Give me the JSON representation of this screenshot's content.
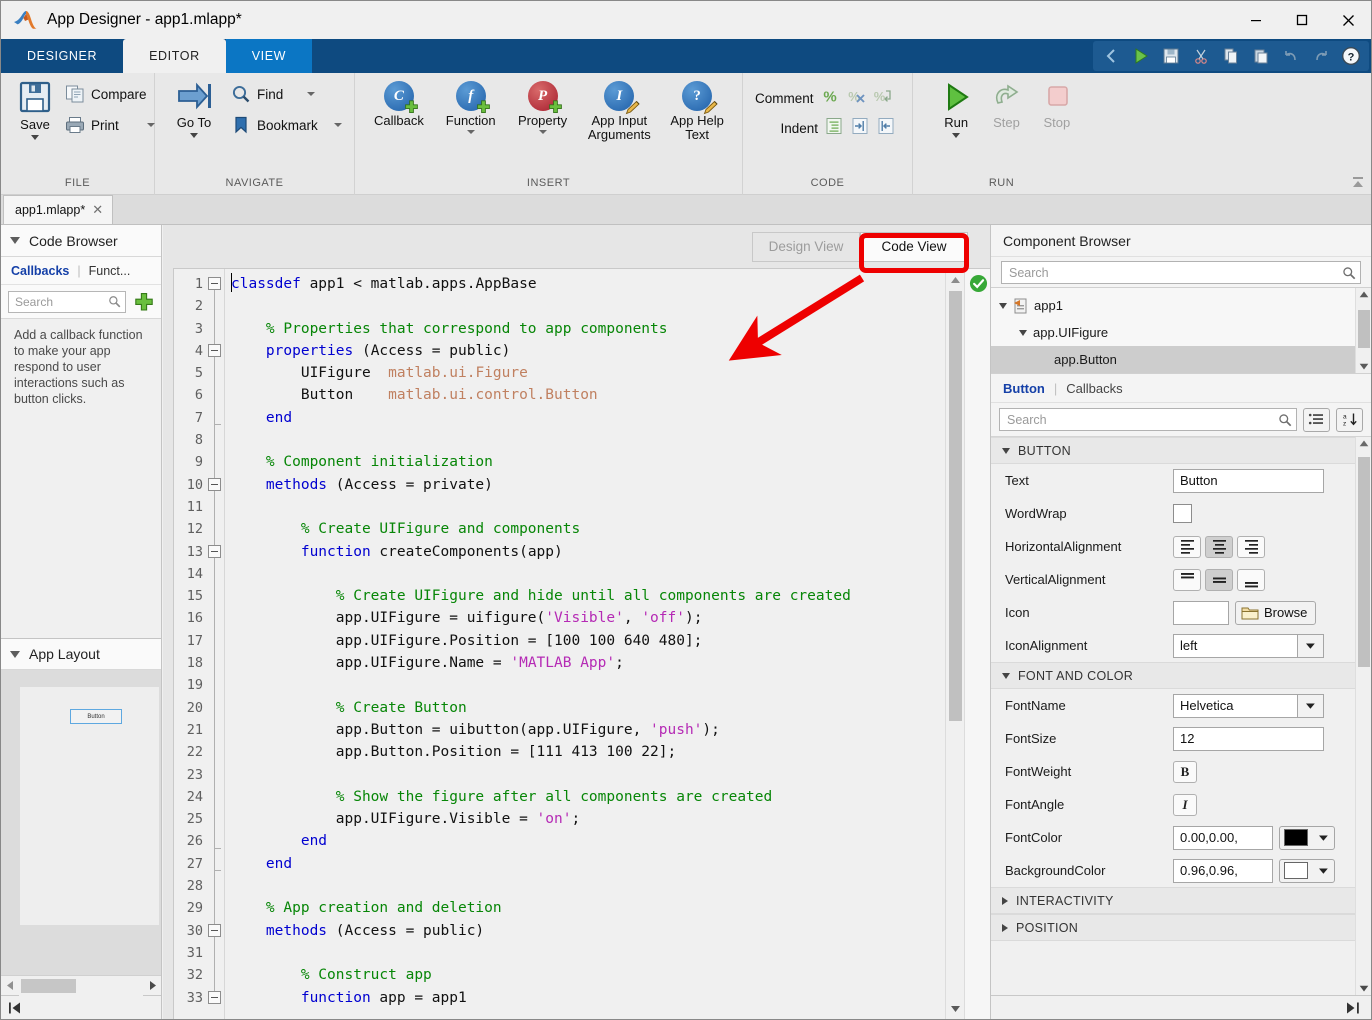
{
  "window": {
    "title": "App Designer - app1.mlapp*",
    "logo": "matlab-logo-icon",
    "minimize": "–",
    "maximize": "☐",
    "close": "✕"
  },
  "ribbon": {
    "tabs": [
      {
        "label": "DESIGNER",
        "active": false
      },
      {
        "label": "EDITOR",
        "active": true
      },
      {
        "label": "VIEW",
        "active": false
      }
    ],
    "quick_access": [
      "back-chevron-icon",
      "run-icon",
      "save-icon",
      "cut-icon",
      "copy-icon",
      "paste-icon",
      "undo-icon",
      "redo-icon",
      "help-icon"
    ],
    "groups": [
      {
        "title": "FILE",
        "items": [
          {
            "label": "Save",
            "icon": "save-floppy-icon",
            "dropdown": true
          },
          {
            "label": "Compare",
            "icon": "compare-icon"
          },
          {
            "label": "Print",
            "icon": "printer-icon",
            "dropdown": true
          }
        ]
      },
      {
        "title": "NAVIGATE",
        "items": [
          {
            "label": "Go To",
            "icon": "goto-arrow-icon",
            "dropdown": true
          },
          {
            "label": "Find",
            "icon": "magnifier-icon",
            "dropdown": true
          },
          {
            "label": "Bookmark",
            "icon": "bookmark-icon",
            "dropdown": true
          }
        ]
      },
      {
        "title": "INSERT",
        "items": [
          {
            "label": "Callback",
            "icon": "add-callback-icon",
            "glyph": "C",
            "color": "#1f5fa8"
          },
          {
            "label": "Function",
            "icon": "add-function-icon",
            "glyph": "f",
            "color": "#1f5fa8",
            "dropdown": true
          },
          {
            "label": "Property",
            "icon": "add-property-icon",
            "glyph": "P",
            "color": "#a51d2d",
            "dropdown": true
          },
          {
            "label": "App Input Arguments",
            "icon": "app-input-arguments-icon",
            "glyph": "I",
            "color": "#1f5fa8"
          },
          {
            "label": "App Help Text",
            "icon": "app-help-text-icon",
            "glyph": "?",
            "color": "#1f5fa8"
          }
        ]
      },
      {
        "title": "CODE",
        "items": [
          {
            "label": "Comment",
            "icons": [
              "comment-percent-icon",
              "uncomment-icon",
              "wrap-comment-icon"
            ]
          },
          {
            "label": "Indent",
            "icons": [
              "smart-indent-icon",
              "indent-right-icon",
              "indent-left-icon"
            ]
          }
        ]
      },
      {
        "title": "RUN",
        "items": [
          {
            "label": "Run",
            "icon": "run-play-icon",
            "dropdown": true,
            "enabled": true
          },
          {
            "label": "Step",
            "icon": "step-icon",
            "enabled": false
          },
          {
            "label": "Stop",
            "icon": "stop-icon",
            "enabled": false
          }
        ]
      }
    ],
    "collapse_icon": "collapse-ribbon-icon"
  },
  "doc_tabs": [
    {
      "label": "app1.mlapp*",
      "close": "✕",
      "active": true
    }
  ],
  "code_browser": {
    "panel_title": "Code Browser",
    "tabs": [
      {
        "label": "Callbacks",
        "active": true
      },
      {
        "label": "Funct...",
        "active": false
      }
    ],
    "search_placeholder": "Search",
    "add_icon": "green-plus-icon",
    "hint": "Add a callback function to make your app respond to user interactions such as button clicks."
  },
  "app_layout": {
    "panel_title": "App Layout",
    "preview_button_label": "Button"
  },
  "view_toggle": {
    "design_view": "Design View",
    "code_view": "Code View",
    "selected": "Code View"
  },
  "editor": {
    "status_icon": "ok-check-icon",
    "line_count": 33,
    "fold_markers": [
      1,
      4,
      10,
      13,
      30,
      33
    ],
    "fold_end_ticks": [
      7,
      26,
      27
    ],
    "lines": [
      {
        "n": 1,
        "tokens": [
          {
            "t": "classdef",
            "c": "kw"
          },
          {
            "t": " app1 < matlab.apps.AppBase",
            "c": "pl"
          }
        ]
      },
      {
        "n": 2,
        "tokens": []
      },
      {
        "n": 3,
        "tokens": [
          {
            "t": "    % Properties that correspond to app components",
            "c": "cm"
          }
        ]
      },
      {
        "n": 4,
        "tokens": [
          {
            "t": "    ",
            "c": "pl"
          },
          {
            "t": "properties",
            "c": "kw"
          },
          {
            "t": " (Access = public)",
            "c": "pl"
          }
        ]
      },
      {
        "n": 5,
        "tokens": [
          {
            "t": "        UIFigure  ",
            "c": "pl"
          },
          {
            "t": "matlab.ui.Figure",
            "c": "cls"
          }
        ]
      },
      {
        "n": 6,
        "tokens": [
          {
            "t": "        Button    ",
            "c": "pl"
          },
          {
            "t": "matlab.ui.control.Button",
            "c": "cls"
          }
        ]
      },
      {
        "n": 7,
        "tokens": [
          {
            "t": "    ",
            "c": "pl"
          },
          {
            "t": "end",
            "c": "kw"
          }
        ]
      },
      {
        "n": 8,
        "tokens": []
      },
      {
        "n": 9,
        "tokens": [
          {
            "t": "    % Component initialization",
            "c": "cm"
          }
        ]
      },
      {
        "n": 10,
        "tokens": [
          {
            "t": "    ",
            "c": "pl"
          },
          {
            "t": "methods",
            "c": "kw"
          },
          {
            "t": " (Access = private)",
            "c": "pl"
          }
        ]
      },
      {
        "n": 11,
        "tokens": []
      },
      {
        "n": 12,
        "tokens": [
          {
            "t": "        % Create UIFigure and components",
            "c": "cm"
          }
        ]
      },
      {
        "n": 13,
        "tokens": [
          {
            "t": "        ",
            "c": "pl"
          },
          {
            "t": "function",
            "c": "kw"
          },
          {
            "t": " createComponents(app)",
            "c": "pl"
          }
        ]
      },
      {
        "n": 14,
        "tokens": []
      },
      {
        "n": 15,
        "tokens": [
          {
            "t": "            % Create UIFigure and hide until all components are created",
            "c": "cm"
          }
        ]
      },
      {
        "n": 16,
        "tokens": [
          {
            "t": "            app.UIFigure = uifigure(",
            "c": "pl"
          },
          {
            "t": "'Visible'",
            "c": "st"
          },
          {
            "t": ", ",
            "c": "pl"
          },
          {
            "t": "'off'",
            "c": "st"
          },
          {
            "t": ");",
            "c": "pl"
          }
        ]
      },
      {
        "n": 17,
        "tokens": [
          {
            "t": "            app.UIFigure.Position = [100 100 640 480];",
            "c": "pl"
          }
        ]
      },
      {
        "n": 18,
        "tokens": [
          {
            "t": "            app.UIFigure.Name = ",
            "c": "pl"
          },
          {
            "t": "'MATLAB App'",
            "c": "st"
          },
          {
            "t": ";",
            "c": "pl"
          }
        ]
      },
      {
        "n": 19,
        "tokens": []
      },
      {
        "n": 20,
        "tokens": [
          {
            "t": "            % Create Button",
            "c": "cm"
          }
        ]
      },
      {
        "n": 21,
        "tokens": [
          {
            "t": "            app.Button = uibutton(app.UIFigure, ",
            "c": "pl"
          },
          {
            "t": "'push'",
            "c": "st"
          },
          {
            "t": ");",
            "c": "pl"
          }
        ]
      },
      {
        "n": 22,
        "tokens": [
          {
            "t": "            app.Button.Position = [111 413 100 22];",
            "c": "pl"
          }
        ]
      },
      {
        "n": 23,
        "tokens": []
      },
      {
        "n": 24,
        "tokens": [
          {
            "t": "            % Show the figure after all components are created",
            "c": "cm"
          }
        ]
      },
      {
        "n": 25,
        "tokens": [
          {
            "t": "            app.UIFigure.Visible = ",
            "c": "pl"
          },
          {
            "t": "'on'",
            "c": "st"
          },
          {
            "t": ";",
            "c": "pl"
          }
        ]
      },
      {
        "n": 26,
        "tokens": [
          {
            "t": "        ",
            "c": "pl"
          },
          {
            "t": "end",
            "c": "kw"
          }
        ]
      },
      {
        "n": 27,
        "tokens": [
          {
            "t": "    ",
            "c": "pl"
          },
          {
            "t": "end",
            "c": "kw"
          }
        ]
      },
      {
        "n": 28,
        "tokens": []
      },
      {
        "n": 29,
        "tokens": [
          {
            "t": "    % App creation and deletion",
            "c": "cm"
          }
        ]
      },
      {
        "n": 30,
        "tokens": [
          {
            "t": "    ",
            "c": "pl"
          },
          {
            "t": "methods",
            "c": "kw"
          },
          {
            "t": " (Access = public)",
            "c": "pl"
          }
        ]
      },
      {
        "n": 31,
        "tokens": []
      },
      {
        "n": 32,
        "tokens": [
          {
            "t": "        % Construct app",
            "c": "cm"
          }
        ]
      },
      {
        "n": 33,
        "tokens": [
          {
            "t": "        ",
            "c": "pl"
          },
          {
            "t": "function",
            "c": "kw"
          },
          {
            "t": " app = app1",
            "c": "pl"
          }
        ]
      }
    ]
  },
  "component_browser": {
    "title": "Component Browser",
    "search_placeholder": "Search",
    "tree": [
      {
        "label": "app1",
        "depth": 0,
        "expanded": true,
        "icon": "app-file-icon",
        "selected": false
      },
      {
        "label": "app.UIFigure",
        "depth": 1,
        "expanded": true,
        "selected": false
      },
      {
        "label": "app.Button",
        "depth": 2,
        "expanded": false,
        "selected": true
      }
    ]
  },
  "inspector": {
    "tabs": [
      {
        "label": "Button",
        "active": true
      },
      {
        "label": "Callbacks",
        "active": false
      }
    ],
    "search_placeholder": "Search",
    "view_buttons": [
      "grouped-list-icon",
      "sort-alpha-icon"
    ],
    "sections": [
      {
        "name": "BUTTON",
        "expanded": true,
        "rows": [
          {
            "label": "Text",
            "kind": "text",
            "value": "Button"
          },
          {
            "label": "WordWrap",
            "kind": "checkbox",
            "checked": false
          },
          {
            "label": "HorizontalAlignment",
            "kind": "align3",
            "options": [
              "align-left-icon",
              "align-center-icon",
              "align-right-icon"
            ],
            "selected": 1
          },
          {
            "label": "VerticalAlignment",
            "kind": "valign3",
            "options": [
              "align-top-icon",
              "align-middle-icon",
              "align-bottom-icon"
            ],
            "selected": 1
          },
          {
            "label": "Icon",
            "kind": "file",
            "value": "",
            "button_label": "Browse",
            "button_icon": "folder-icon"
          },
          {
            "label": "IconAlignment",
            "kind": "dropdown",
            "value": "left"
          }
        ]
      },
      {
        "name": "FONT AND COLOR",
        "expanded": true,
        "rows": [
          {
            "label": "FontName",
            "kind": "dropdown",
            "value": "Helvetica"
          },
          {
            "label": "FontSize",
            "kind": "text",
            "value": "12"
          },
          {
            "label": "FontWeight",
            "kind": "toggle",
            "glyph": "B"
          },
          {
            "label": "FontAngle",
            "kind": "toggle",
            "glyph": "I"
          },
          {
            "label": "FontColor",
            "kind": "color",
            "value": "0.00,0.00,",
            "swatch": "#000000"
          },
          {
            "label": "BackgroundColor",
            "kind": "color",
            "value": "0.96,0.96,",
            "swatch": "#ffffff"
          }
        ]
      },
      {
        "name": "INTERACTIVITY",
        "expanded": false,
        "rows": []
      },
      {
        "name": "POSITION",
        "expanded": false,
        "rows": []
      }
    ]
  },
  "annotation": {
    "highlight_target": "Code View",
    "highlight_color": "#ee0000",
    "arrow": "red-arrow-pointing-down-left"
  },
  "footer": {
    "left_collapse_icon": "collapse-left-icon",
    "right_expand_icon": "expand-right-icon"
  }
}
